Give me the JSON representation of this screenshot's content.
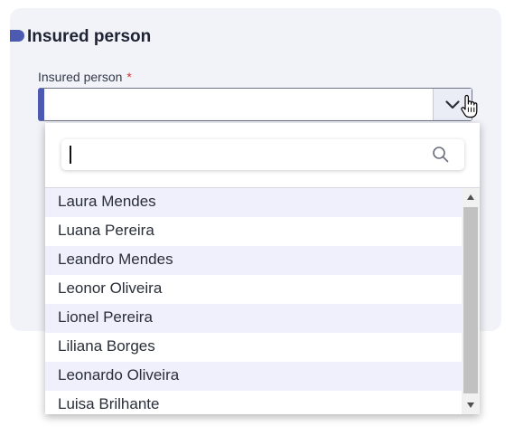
{
  "section": {
    "title": "Insured person"
  },
  "field": {
    "label": "Insured person",
    "required_mark": "*",
    "value": ""
  },
  "dropdown": {
    "search_value": "",
    "options": [
      "Laura Mendes",
      "Luana Pereira",
      "Leandro Mendes",
      "Leonor Oliveira",
      "Lionel Pereira",
      "Liliana Borges",
      "Leonardo Oliveira",
      "Luisa Brilhante"
    ]
  },
  "colors": {
    "accent": "#4c5bb1",
    "required": "#d0332f",
    "row_stripe": "#eff0fb",
    "card_background": "#f2f3f9"
  },
  "icons": {
    "toggle": "chevron-down-icon",
    "search": "search-icon",
    "cursor": "hand-cursor-icon"
  }
}
